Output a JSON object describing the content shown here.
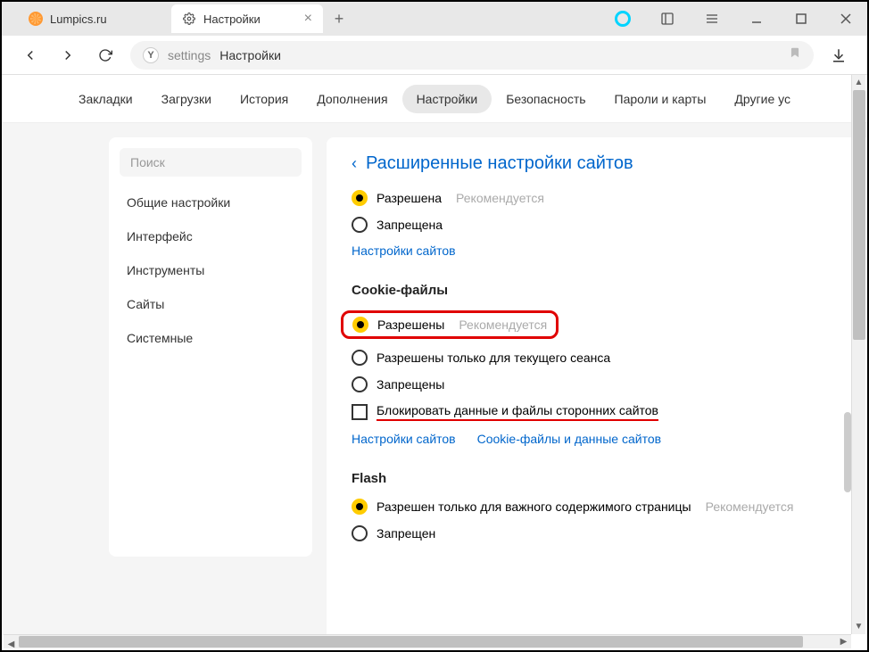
{
  "tabs": [
    {
      "label": "Lumpics.ru",
      "icon": "lumpics"
    },
    {
      "label": "Настройки",
      "icon": "gear",
      "active": true
    }
  ],
  "address": {
    "prefix": "settings",
    "title": "Настройки"
  },
  "topnav": [
    "Закладки",
    "Загрузки",
    "История",
    "Дополнения",
    "Настройки",
    "Безопасность",
    "Пароли и карты",
    "Другие ус"
  ],
  "topnav_active": 4,
  "sidebar": {
    "search_placeholder": "Поиск",
    "items": [
      "Общие настройки",
      "Интерфейс",
      "Инструменты",
      "Сайты",
      "Системные"
    ]
  },
  "panel": {
    "title": "Расширенные настройки сайтов",
    "section1": {
      "allowed": "Разрешена",
      "forbidden": "Запрещена",
      "hint": "Рекомендуется",
      "link": "Настройки сайтов"
    },
    "cookies": {
      "title": "Cookie-файлы",
      "opt1": "Разрешены",
      "opt1_hint": "Рекомендуется",
      "opt2": "Разрешены только для текущего сеанса",
      "opt3": "Запрещены",
      "opt4": "Блокировать данные и файлы сторонних сайтов",
      "link1": "Настройки сайтов",
      "link2": "Cookie-файлы и данные сайтов"
    },
    "flash": {
      "title": "Flash",
      "opt1": "Разрешен только для важного содержимого страницы",
      "opt1_hint": "Рекомендуется",
      "opt2": "Запрещен"
    }
  }
}
